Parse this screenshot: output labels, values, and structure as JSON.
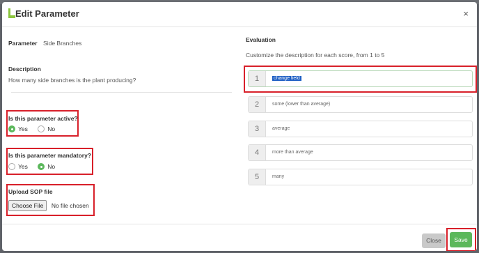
{
  "modal": {
    "title": "Edit Parameter",
    "close_icon": "×"
  },
  "parameter": {
    "label": "Parameter",
    "value": "Side Branches"
  },
  "description": {
    "label": "Description",
    "text": "How many side branches is the plant producing?"
  },
  "active": {
    "question": "Is this parameter active?",
    "options": [
      "Yes",
      "No"
    ],
    "selected": "Yes"
  },
  "mandatory": {
    "question": "Is this parameter mandatory?",
    "options": [
      "Yes",
      "No"
    ],
    "selected": "No"
  },
  "upload": {
    "label": "Upload SOP file",
    "button": "Choose File",
    "status": "No file chosen"
  },
  "evaluation": {
    "title": "Evaluation",
    "subtitle": "Customize the description for each score, from 1 to 5",
    "scores": [
      {
        "number": "1",
        "text": "change field"
      },
      {
        "number": "2",
        "text": "some (lower than average)"
      },
      {
        "number": "3",
        "text": "average"
      },
      {
        "number": "4",
        "text": "more than average"
      },
      {
        "number": "5",
        "text": "many"
      }
    ]
  },
  "footer": {
    "close_label": "Close",
    "save_label": "Save"
  },
  "colors": {
    "accent_green": "#5cb85c",
    "highlight_red": "#d8202a",
    "selection_blue": "#1e5fc4"
  }
}
